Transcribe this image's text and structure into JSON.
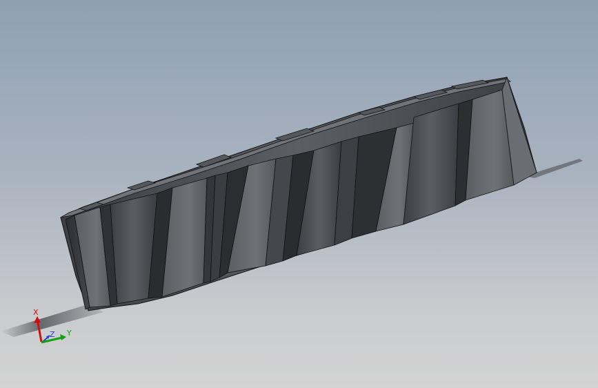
{
  "viewport": {
    "background_top": "#8fa0b4",
    "background_bottom": "#d3d3d3"
  },
  "model": {
    "body_color": "#4a4d52",
    "edge_color": "#111111",
    "shadow_color": "#4e5156"
  },
  "triad": {
    "x_label": "X",
    "y_label": "Y",
    "z_label": "Z",
    "x_color": "#d01010",
    "y_color": "#10a010",
    "z_color": "#2a3ad0"
  }
}
